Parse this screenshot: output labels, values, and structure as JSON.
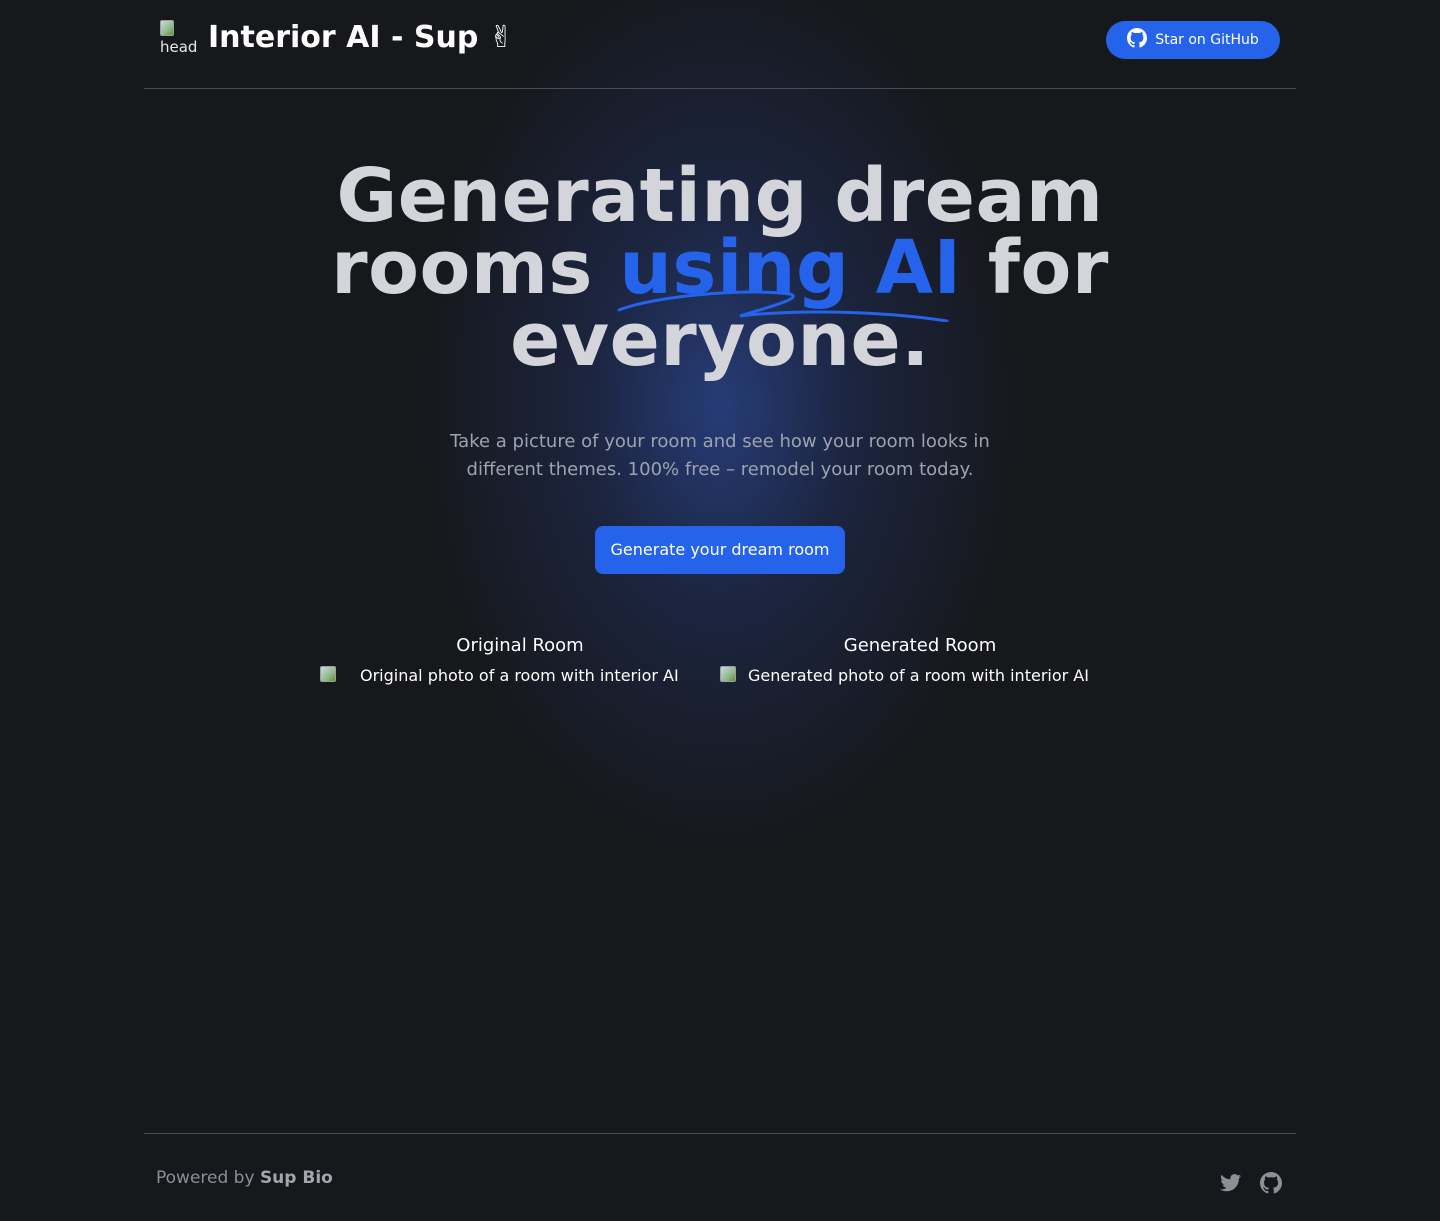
{
  "header": {
    "logo_alt": "head",
    "title": "Interior AI - Sup ✌",
    "github_button": "Star on GitHub"
  },
  "hero": {
    "headline_start": "Generating dream rooms ",
    "headline_accent": "using AI",
    "headline_end": " for everyone.",
    "subtitle": "Take a picture of your room and see how your room looks in different themes. 100% free – remodel your room today.",
    "cta": "Generate your dream room"
  },
  "compare": {
    "original_title": "Original Room",
    "original_alt": "Original photo of a room with interior AI",
    "generated_title": "Generated Room",
    "generated_alt": "Generated photo of a room with interior AI"
  },
  "footer": {
    "powered_prefix": "Powered by ",
    "powered_brand": "Sup Bio",
    "social_icons": [
      "twitter-icon",
      "github-icon"
    ]
  },
  "colors": {
    "background": "#17181c",
    "accent": "#2563eb",
    "headline": "#d4d5db",
    "muted": "#9ca3af"
  }
}
